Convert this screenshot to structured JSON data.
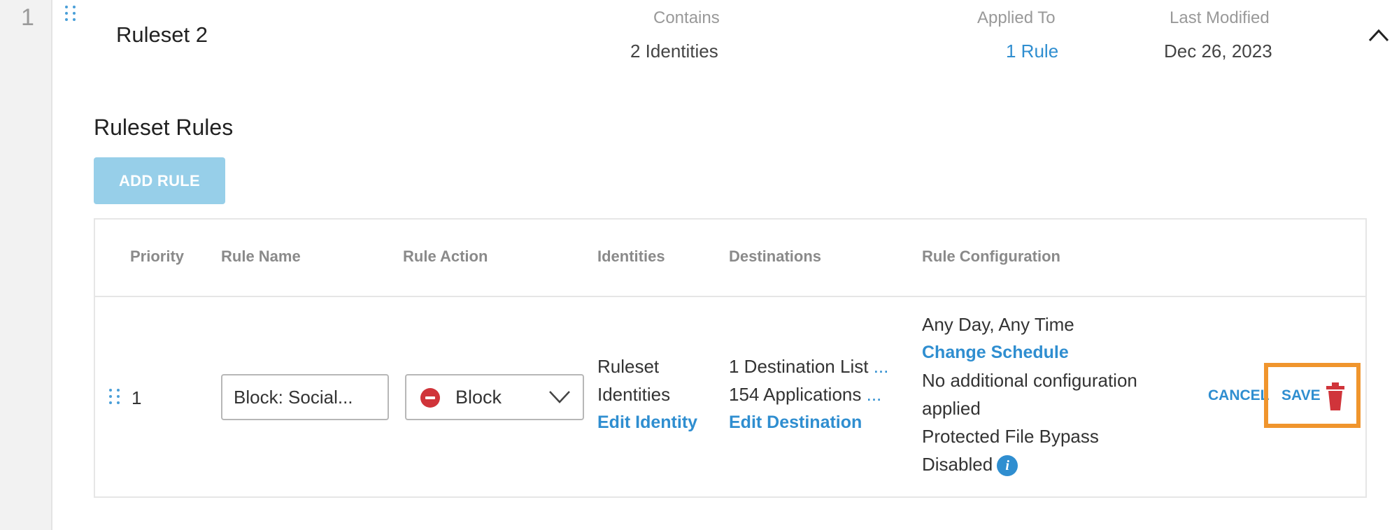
{
  "row_index": "1",
  "ruleset": {
    "name": "Ruleset 2",
    "contains_label": "Contains",
    "contains_value": "2 Identities",
    "applied_to_label": "Applied To",
    "applied_to_value": "1 Rule",
    "last_modified_label": "Last Modified",
    "last_modified_value": "Dec 26, 2023"
  },
  "section_title": "Ruleset Rules",
  "add_rule_label": "ADD RULE",
  "table": {
    "headers": {
      "priority": "Priority",
      "rule_name": "Rule Name",
      "rule_action": "Rule Action",
      "identities": "Identities",
      "destinations": "Destinations",
      "rule_configuration": "Rule Configuration"
    },
    "rows": [
      {
        "priority": "1",
        "rule_name": "Block: Social...",
        "action": "Block",
        "identities_line1": "Ruleset",
        "identities_line2": "Identities",
        "edit_identity": "Edit Identity",
        "destinations_line1": "1 Destination List",
        "destinations_line2": "154 Applications",
        "truncation": "...",
        "edit_destination": "Edit Destination",
        "schedule": "Any Day, Any Time",
        "change_schedule": "Change Schedule",
        "config_line1": "No additional configuration",
        "config_line2": "applied",
        "bypass_line1": "Protected File Bypass",
        "bypass_line2": "Disabled",
        "info_glyph": "i",
        "cancel": "CANCEL",
        "save": "SAVE"
      }
    ]
  },
  "icons": {
    "drag": "drag-handle-icon",
    "chevron": "chevron-up-icon",
    "block": "block-icon",
    "select": "chevron-down-icon",
    "info": "info-icon",
    "trash": "trash-icon"
  },
  "colors": {
    "accent": "#2f8ed0",
    "button_disabled": "#97cfe9",
    "block_red": "#d0343a",
    "highlight": "#f0952d"
  }
}
